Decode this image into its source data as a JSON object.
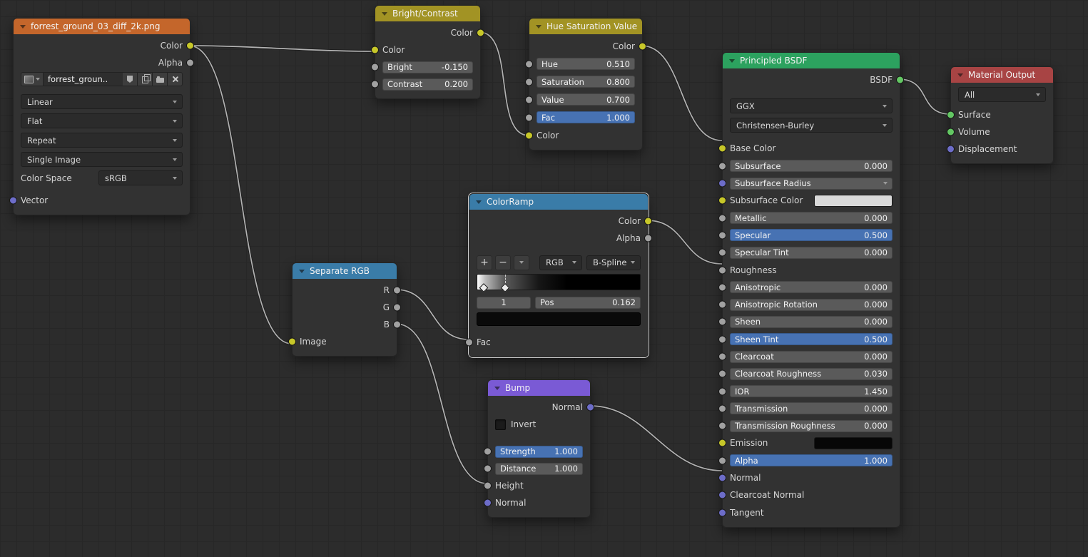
{
  "colors": {
    "header_texture": "#c4662b",
    "header_color": "#a29324",
    "header_shader": "#2ca25f",
    "header_output": "#a84444",
    "header_converter": "#3a7ca8",
    "header_vector": "#7a5ad5",
    "socket_color": "#c7c729",
    "socket_value": "#a1a1a1",
    "socket_shader": "#63c763",
    "socket_vector": "#6d6dc9",
    "field_highlight": "#4772b3"
  },
  "nodes": {
    "image_texture": {
      "title": "forrest_ground_03_diff_2k.png",
      "outputs": {
        "color": "Color",
        "alpha": "Alpha"
      },
      "image_name": "forrest_groun..",
      "interpolation": "Linear",
      "projection": "Flat",
      "extension": "Repeat",
      "source": "Single Image",
      "color_space_label": "Color Space",
      "color_space": "sRGB",
      "inputs": {
        "vector": "Vector"
      }
    },
    "bright_contrast": {
      "title": "Bright/Contrast",
      "outputs": {
        "color": "Color"
      },
      "inputs": {
        "color": "Color"
      },
      "fields": [
        {
          "label": "Bright",
          "value": "-0.150"
        },
        {
          "label": "Contrast",
          "value": "0.200"
        }
      ]
    },
    "hue_saturation": {
      "title": "Hue Saturation Value",
      "outputs": {
        "color": "Color"
      },
      "fields": [
        {
          "label": "Hue",
          "value": "0.510"
        },
        {
          "label": "Saturation",
          "value": "0.800"
        },
        {
          "label": "Value",
          "value": "0.700"
        },
        {
          "label": "Fac",
          "value": "1.000"
        }
      ],
      "inputs": {
        "color": "Color"
      }
    },
    "colorramp": {
      "title": "ColorRamp",
      "outputs": {
        "color": "Color",
        "alpha": "Alpha"
      },
      "tools": {
        "add": "+",
        "remove": "−"
      },
      "mode": "RGB",
      "interpolation": "B-Spline",
      "index": "1",
      "pos_label": "Pos",
      "pos_value": "0.162",
      "inputs": {
        "fac": "Fac"
      }
    },
    "separate_rgb": {
      "title": "Separate RGB",
      "outputs": {
        "r": "R",
        "g": "G",
        "b": "B"
      },
      "inputs": {
        "image": "Image"
      }
    },
    "bump": {
      "title": "Bump",
      "outputs": {
        "normal": "Normal"
      },
      "invert_label": "Invert",
      "fields": [
        {
          "label": "Strength",
          "value": "1.000"
        },
        {
          "label": "Distance",
          "value": "1.000"
        }
      ],
      "inputs": {
        "height": "Height",
        "normal": "Normal"
      }
    },
    "principled": {
      "title": "Principled BSDF",
      "outputs": {
        "bsdf": "BSDF"
      },
      "distribution": "GGX",
      "subsurface_method": "Christensen-Burley",
      "rows": [
        {
          "label": "Base Color"
        },
        {
          "label": "Subsurface",
          "value": "0.000"
        },
        {
          "label": "Subsurface Radius"
        },
        {
          "label": "Subsurface Color"
        },
        {
          "label": "Metallic",
          "value": "0.000"
        },
        {
          "label": "Specular",
          "value": "0.500"
        },
        {
          "label": "Specular Tint",
          "value": "0.000"
        },
        {
          "label": "Roughness"
        },
        {
          "label": "Anisotropic",
          "value": "0.000"
        },
        {
          "label": "Anisotropic Rotation",
          "value": "0.000"
        },
        {
          "label": "Sheen",
          "value": "0.000"
        },
        {
          "label": "Sheen Tint",
          "value": "0.500"
        },
        {
          "label": "Clearcoat",
          "value": "0.000"
        },
        {
          "label": "Clearcoat Roughness",
          "value": "0.030"
        },
        {
          "label": "IOR",
          "value": "1.450"
        },
        {
          "label": "Transmission",
          "value": "0.000"
        },
        {
          "label": "Transmission Roughness",
          "value": "0.000"
        },
        {
          "label": "Emission"
        },
        {
          "label": "Alpha",
          "value": "1.000"
        },
        {
          "label": "Normal"
        },
        {
          "label": "Clearcoat Normal"
        },
        {
          "label": "Tangent"
        }
      ]
    },
    "material_output": {
      "title": "Material Output",
      "target": "All",
      "inputs": {
        "surface": "Surface",
        "volume": "Volume",
        "displacement": "Displacement"
      }
    }
  },
  "connections": [
    {
      "from": "Image Texture.Color",
      "to": "Bright/Contrast.Color"
    },
    {
      "from": "Image Texture.Color",
      "to": "Separate RGB.Image"
    },
    {
      "from": "Bright/Contrast.Color",
      "to": "Hue Saturation Value.Color"
    },
    {
      "from": "Hue Saturation Value.Color",
      "to": "Principled BSDF.Base Color"
    },
    {
      "from": "Separate RGB.R",
      "to": "ColorRamp.Fac"
    },
    {
      "from": "Separate RGB.B",
      "to": "Bump.Height"
    },
    {
      "from": "ColorRamp.Color",
      "to": "Principled BSDF.Roughness"
    },
    {
      "from": "Bump.Normal",
      "to": "Principled BSDF.Normal"
    },
    {
      "from": "Principled BSDF.BSDF",
      "to": "Material Output.Surface"
    }
  ]
}
